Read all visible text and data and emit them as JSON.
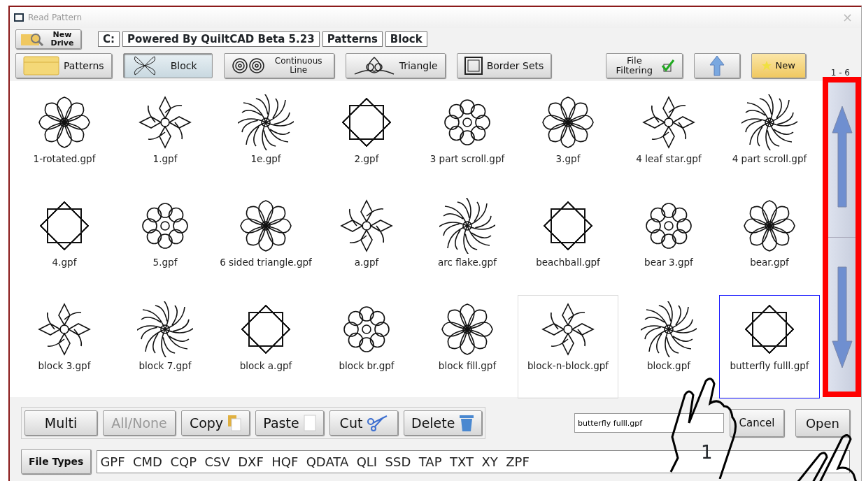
{
  "window": {
    "title": "Read Pattern",
    "close": "×"
  },
  "drive_button": {
    "label": "New Drive"
  },
  "path": [
    "C:",
    "Powered By QuiltCAD Beta 5.23",
    "Patterns",
    "Block"
  ],
  "categories": [
    {
      "label": "Patterns",
      "selected": false
    },
    {
      "label": "Block",
      "selected": true
    },
    {
      "label": "Continuous Line",
      "selected": false
    },
    {
      "label": "Triangle",
      "selected": false
    },
    {
      "label": "Border Sets",
      "selected": false
    }
  ],
  "tools": [
    {
      "kind": "filter",
      "label": "File Filtering"
    },
    {
      "kind": "up"
    },
    {
      "kind": "new",
      "label": "New"
    }
  ],
  "page_range": "1 - 6",
  "files": [
    {
      "name": "1-rotated.gpf",
      "selected": false,
      "hovered": false
    },
    {
      "name": "1.gpf",
      "selected": false,
      "hovered": false
    },
    {
      "name": "1e.gpf",
      "selected": false,
      "hovered": false
    },
    {
      "name": "2.gpf",
      "selected": false,
      "hovered": false
    },
    {
      "name": "3 part scroll.gpf",
      "selected": false,
      "hovered": false
    },
    {
      "name": "3.gpf",
      "selected": false,
      "hovered": false
    },
    {
      "name": "4 leaf star.gpf",
      "selected": false,
      "hovered": false
    },
    {
      "name": "4 part scroll.gpf",
      "selected": false,
      "hovered": false
    },
    {
      "name": "4.gpf",
      "selected": false,
      "hovered": false
    },
    {
      "name": "5.gpf",
      "selected": false,
      "hovered": false
    },
    {
      "name": "6 sided triangle.gpf",
      "selected": false,
      "hovered": false
    },
    {
      "name": "a.gpf",
      "selected": false,
      "hovered": false
    },
    {
      "name": "arc flake.gpf",
      "selected": false,
      "hovered": false
    },
    {
      "name": "beachball.gpf",
      "selected": false,
      "hovered": false
    },
    {
      "name": "bear 3.gpf",
      "selected": false,
      "hovered": false
    },
    {
      "name": "bear.gpf",
      "selected": false,
      "hovered": false
    },
    {
      "name": "block 3.gpf",
      "selected": false,
      "hovered": false
    },
    {
      "name": "block 7.gpf",
      "selected": false,
      "hovered": false
    },
    {
      "name": "block a.gpf",
      "selected": false,
      "hovered": false
    },
    {
      "name": "block br.gpf",
      "selected": false,
      "hovered": false
    },
    {
      "name": "block fill.gpf",
      "selected": false,
      "hovered": false
    },
    {
      "name": "block-n-block.gpf",
      "selected": false,
      "hovered": true
    },
    {
      "name": "block.gpf",
      "selected": false,
      "hovered": false
    },
    {
      "name": "butterfly fulll.gpf",
      "selected": true,
      "hovered": false
    }
  ],
  "actions": [
    {
      "label": "Multi",
      "disabled": false
    },
    {
      "label": "All/None",
      "disabled": true
    },
    {
      "label": "Copy",
      "disabled": false
    },
    {
      "label": "Paste",
      "disabled": false
    },
    {
      "label": "Cut",
      "disabled": false
    },
    {
      "label": "Delete",
      "disabled": false
    }
  ],
  "filename": {
    "value": "butterfly fulll.gpf"
  },
  "dialog_buttons": [
    "Cancel",
    "Open"
  ],
  "file_types": {
    "label": "File Types",
    "value": "GPF  CMD  CQP  CSV  DXF  HQF  QDATA  QLI  SSD  TAP  TXT  XY  ZPF"
  },
  "annotation": {
    "step": "1"
  }
}
